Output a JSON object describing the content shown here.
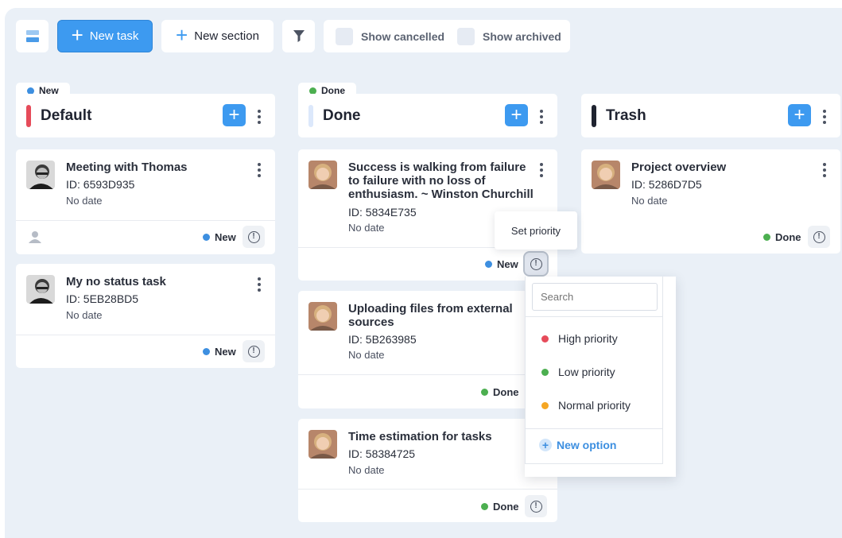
{
  "toolbar": {
    "new_task": "New task",
    "new_section": "New section",
    "show_cancelled": "Show cancelled",
    "show_archived": "Show archived"
  },
  "colors": {
    "accent": "#3d9af0",
    "new": "#3d8fe0",
    "done": "#4caf50",
    "default_stripe": "#e64b5a",
    "trash_stripe": "#1f2330"
  },
  "columns": [
    {
      "tag": "New",
      "title": "Default",
      "stripe": "#e64b5a",
      "cards": [
        {
          "title": "Meeting with Thomas",
          "id": "ID: 6593D935",
          "date": "No date",
          "status": "New"
        },
        {
          "title": "My no status task",
          "id": "ID: 5EB28BD5",
          "date": "No date",
          "status": "New"
        }
      ]
    },
    {
      "tag": "Done",
      "title": "Done",
      "stripe": "#dce8fb",
      "cards": [
        {
          "title": "Success is walking from failure to failure with no loss of enthusiasm. ~ Winston Churchill",
          "id": "ID: 5834E735",
          "date": "No date",
          "status": "New"
        },
        {
          "title": "Uploading files from external sources",
          "id": "ID: 5B263985",
          "date": "No date",
          "status": "Done"
        },
        {
          "title": "Time estimation for tasks",
          "id": "ID: 58384725",
          "date": "No date",
          "status": "Done"
        }
      ]
    },
    {
      "title": "Trash",
      "stripe": "#1f2330",
      "cards": [
        {
          "title": "Project overview",
          "id": "ID: 5286D7D5",
          "date": "No date",
          "status": "Done"
        }
      ]
    }
  ],
  "tooltip": "Set priority",
  "priority_menu": {
    "search_placeholder": "Search",
    "options": [
      {
        "label": "High priority",
        "color": "#e64b5a"
      },
      {
        "label": "Low priority",
        "color": "#4caf50"
      },
      {
        "label": "Normal priority",
        "color": "#f5a623"
      }
    ],
    "new_option": "New option"
  }
}
